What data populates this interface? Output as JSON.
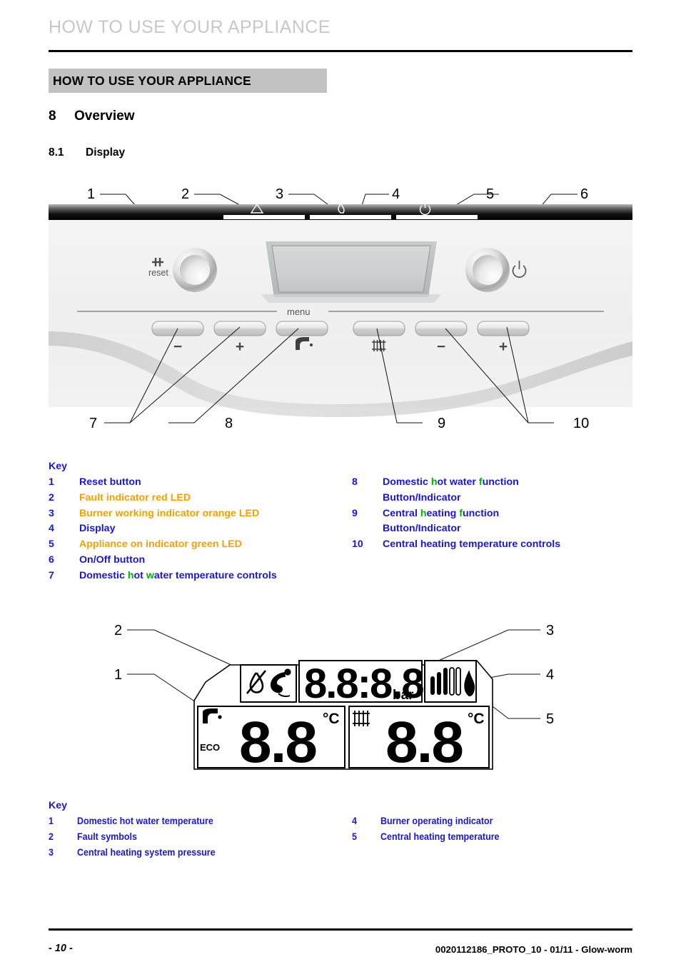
{
  "running_header": "HOW TO USE YOUR APPLIANCE",
  "chapter_bar": "HOW TO USE YOUR APPLIANCE",
  "sections": {
    "s8_num": "8",
    "s8_title": "Overview",
    "s81_num": "8.1",
    "s81_title": "Display"
  },
  "colors": {
    "blue": "#1a14e0",
    "orange": "#f5a000",
    "green": "#00b200",
    "chapter_bar_bg": "#c2c2c2",
    "running_header": "#c8c8c8"
  },
  "figure_panel": {
    "callouts_top": [
      "1",
      "2",
      "3",
      "4",
      "5",
      "6"
    ],
    "callouts_bottom": [
      "7",
      "8",
      "9",
      "10"
    ],
    "reset_label": "reset",
    "menu_label": "menu",
    "led_icons": [
      "warning-triangle-icon",
      "flame-icon",
      "power-icon"
    ],
    "buttons": [
      "minus",
      "plus",
      "tap-icon",
      "radiator-icon",
      "minus",
      "plus"
    ],
    "button_labels": [
      "−",
      "+",
      "",
      "",
      "−",
      "+"
    ],
    "power_icon_label": "power-icon"
  },
  "figure_lcd": {
    "callouts": [
      "1",
      "2",
      "3",
      "4",
      "5"
    ],
    "pressure_value": "8.8:8.8",
    "pressure_unit": "bar",
    "dhw_value": "8.8",
    "dhw_unit": "°C",
    "ch_value": "8.8",
    "ch_unit": "°C",
    "eco_label": "ECO",
    "fault_icons": [
      "no-water-drop-icon",
      "telephone-icon"
    ],
    "tap_icon": "tap-icon",
    "radiator_icon": "radiator-icon",
    "burner_icon": "flame-bars-icon",
    "burner_bars_filled": 3,
    "burner_bars_empty": 2
  },
  "key1": {
    "title": "Key",
    "col1": [
      {
        "n": "1",
        "parts": [
          {
            "t": "Reset button",
            "c": "blue"
          }
        ]
      },
      {
        "n": "2",
        "parts": [
          {
            "t": "Fault indicator red LED",
            "c": "orange"
          }
        ]
      },
      {
        "n": "3",
        "parts": [
          {
            "t": "Burner working indicator orange LED",
            "c": "orange"
          }
        ]
      },
      {
        "n": "4",
        "parts": [
          {
            "t": "Display",
            "c": "blue"
          }
        ]
      },
      {
        "n": "5",
        "parts": [
          {
            "t": "Appliance on indicator green LED",
            "c": "orange"
          }
        ]
      },
      {
        "n": "6",
        "parts": [
          {
            "t": "On/Off button",
            "c": "blue"
          }
        ]
      },
      {
        "n": "7",
        "parts": [
          {
            "t": "Domestic ",
            "c": "blue"
          },
          {
            "t": "h",
            "c": "green"
          },
          {
            "t": "ot ",
            "c": "blue"
          },
          {
            "t": "w",
            "c": "green"
          },
          {
            "t": "ater temperature controls",
            "c": "blue"
          }
        ]
      }
    ],
    "col2": [
      {
        "n": "8",
        "parts": [
          {
            "t": "Domestic ",
            "c": "blue"
          },
          {
            "t": "h",
            "c": "green"
          },
          {
            "t": "ot water ",
            "c": "blue"
          },
          {
            "t": "f",
            "c": "green"
          },
          {
            "t": "unction",
            "c": "blue"
          }
        ]
      },
      {
        "n": "",
        "parts": [
          {
            "t": "Button/Indicator",
            "c": "blue"
          }
        ]
      },
      {
        "n": "9",
        "parts": [
          {
            "t": "Central ",
            "c": "blue"
          },
          {
            "t": "h",
            "c": "green"
          },
          {
            "t": "eating ",
            "c": "blue"
          },
          {
            "t": "f",
            "c": "green"
          },
          {
            "t": "unction",
            "c": "blue"
          }
        ]
      },
      {
        "n": "",
        "parts": [
          {
            "t": "Button/Indicator",
            "c": "blue"
          }
        ]
      },
      {
        "n": "10",
        "parts": [
          {
            "t": "Central heating temperature controls",
            "c": "blue"
          }
        ]
      }
    ]
  },
  "key2": {
    "title": "Key",
    "col1": [
      {
        "n": "1",
        "t": "Domestic hot water temperature"
      },
      {
        "n": "2",
        "t": "Fault symbols"
      },
      {
        "n": "3",
        "t": "Central heating system pressure"
      }
    ],
    "col2": [
      {
        "n": "4",
        "t": "Burner operating indicator"
      },
      {
        "n": "5",
        "t": "Central heating temperature"
      }
    ]
  },
  "footer": {
    "page": "- 10 -",
    "doc": "0020112186_PROTO_10 - 01/11 - Glow-worm"
  }
}
